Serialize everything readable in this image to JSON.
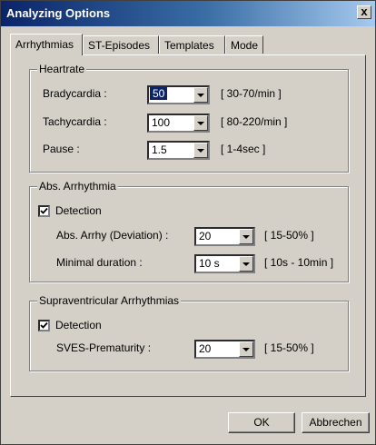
{
  "window": {
    "title": "Analyzing Options",
    "close_glyph": "x"
  },
  "tabs": [
    {
      "label": "Arrhythmias"
    },
    {
      "label": "ST-Episodes"
    },
    {
      "label": "Templates"
    },
    {
      "label": "Mode"
    }
  ],
  "heartrate": {
    "title": "Heartrate",
    "bradycardia": {
      "label": "Bradycardia :",
      "value": "50",
      "range": "[ 30-70/min ]"
    },
    "tachycardia": {
      "label": "Tachycardia :",
      "value": "100",
      "range": "[ 80-220/min ]"
    },
    "pause": {
      "label": "Pause :",
      "value": "1.5",
      "range": "[ 1-4sec ]"
    }
  },
  "abs_arrhythmia": {
    "title": "Abs. Arrhythmia",
    "detection_label": "Detection",
    "detection_checked": true,
    "deviation": {
      "label": "Abs. Arrhy (Deviation) :",
      "value": "20",
      "range": "[ 15-50% ]"
    },
    "duration": {
      "label": "Minimal duration :",
      "value": "10 s",
      "range": "[ 10s - 10min ]"
    }
  },
  "supraventricular": {
    "title": "Supraventricular Arrhythmias",
    "detection_label": "Detection",
    "detection_checked": true,
    "prematurity": {
      "label": "SVES-Prematurity :",
      "value": "20",
      "range": "[ 15-50% ]"
    }
  },
  "buttons": {
    "ok": "OK",
    "cancel": "Abbrechen"
  }
}
